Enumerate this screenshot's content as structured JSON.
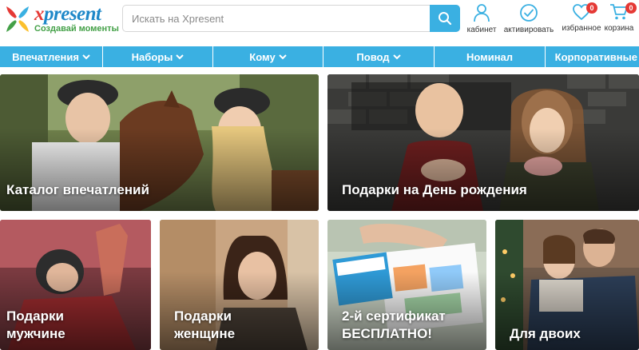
{
  "brand": {
    "name_x": "x",
    "name_rest": "present",
    "slogan": "Создавай моменты"
  },
  "search": {
    "placeholder": "Искать на Xpresent",
    "value": ""
  },
  "header_actions": [
    {
      "label": "кабинет"
    },
    {
      "label": "активировать"
    },
    {
      "label": "избранное",
      "badge": "0"
    },
    {
      "label": "корзина",
      "badge": "0"
    }
  ],
  "nav": [
    {
      "label": "Впечатления"
    },
    {
      "label": "Наборы"
    },
    {
      "label": "Кому"
    },
    {
      "label": "Повод"
    },
    {
      "label": "Номинал"
    },
    {
      "label": "Корпоративные"
    }
  ],
  "tiles": [
    {
      "title": "Каталог впечатлений"
    },
    {
      "title": "Подарки на День рождения"
    },
    {
      "title_line1": "Подарки",
      "title_line2": "мужчине"
    },
    {
      "title_line1": "Подарки",
      "title_line2": "женщине"
    },
    {
      "title_line1": "2-й сертификат",
      "title_line2": "БЕСПЛАТНО!"
    },
    {
      "title": "Для двоих"
    }
  ],
  "colors": {
    "accent": "#3ab0e2",
    "badge": "#e53935",
    "slogan": "#43a047",
    "brand_blue": "#1e88c8"
  }
}
